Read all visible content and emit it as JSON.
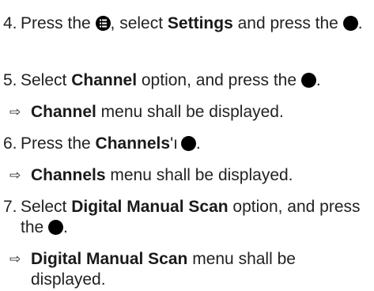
{
  "steps": [
    {
      "number": "4.",
      "part1": "Press the ",
      "after_icon": ", select ",
      "bold1": "Settings",
      "part2": " and press the ",
      "end": ".",
      "icon1": "menu-button-icon",
      "icon2": "ok-button-icon"
    },
    {
      "number": "5.",
      "part1": "Select ",
      "bold1": "Channel",
      "part2": " option, and press the ",
      "end": ".",
      "icon": "ok-button-icon"
    },
    {
      "number": "6.",
      "part1": "Press the ",
      "bold1": "Channels",
      "suffix": "'ı",
      "end": ".",
      "icon": "ok-button-icon"
    },
    {
      "number": "7.",
      "part1": "Select ",
      "bold1": "Digital Manual Scan",
      "part2": " option, and press the ",
      "end": ".",
      "icon": "ok-button-icon"
    }
  ],
  "results": [
    {
      "arrow": "⇨",
      "bold": "Channel",
      "text": " menu shall be displayed."
    },
    {
      "arrow": "⇨",
      "bold": "Channels",
      "text": " menu shall be displayed."
    },
    {
      "arrow": "⇨",
      "bold": "Digital Manual Scan",
      "text": " menu shall be displayed."
    }
  ],
  "colors": {
    "text": "#222222",
    "icon": "#000000"
  }
}
